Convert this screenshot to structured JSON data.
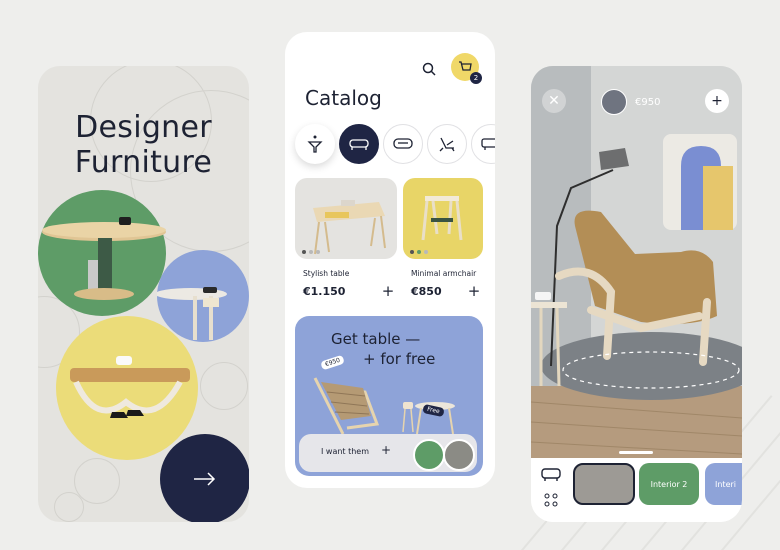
{
  "left_screen": {
    "title_line1": "Designer",
    "title_line2": "Furniture"
  },
  "catalog_screen": {
    "title": "Catalog",
    "cart_count": "2",
    "categories": [
      "filter-icon",
      "sofa-icon",
      "armchair-icon",
      "lounge-chair-icon",
      "cabinet-icon"
    ],
    "products": [
      {
        "name": "Stylish table",
        "price": "€1.150",
        "add_label": "+"
      },
      {
        "name": "Minimal armchair",
        "price": "€850",
        "add_label": "+"
      }
    ],
    "promo": {
      "line1": "Get table —",
      "line2": "+ for free",
      "tag_price": "€950",
      "tag_free": "Free",
      "cta_label": "I want them",
      "cta_plus": "+"
    }
  },
  "ar_screen": {
    "close_label": "✕",
    "add_label": "+",
    "price": "€950",
    "thumbnails": [
      {
        "label": ""
      },
      {
        "label": "Interior 2"
      },
      {
        "label": "Interi"
      }
    ]
  },
  "colors": {
    "navy": "#1f2544",
    "green": "#5e9c67",
    "blue": "#8ea3d8",
    "yellow": "#ebdc79",
    "cart_yellow": "#f0d868"
  }
}
